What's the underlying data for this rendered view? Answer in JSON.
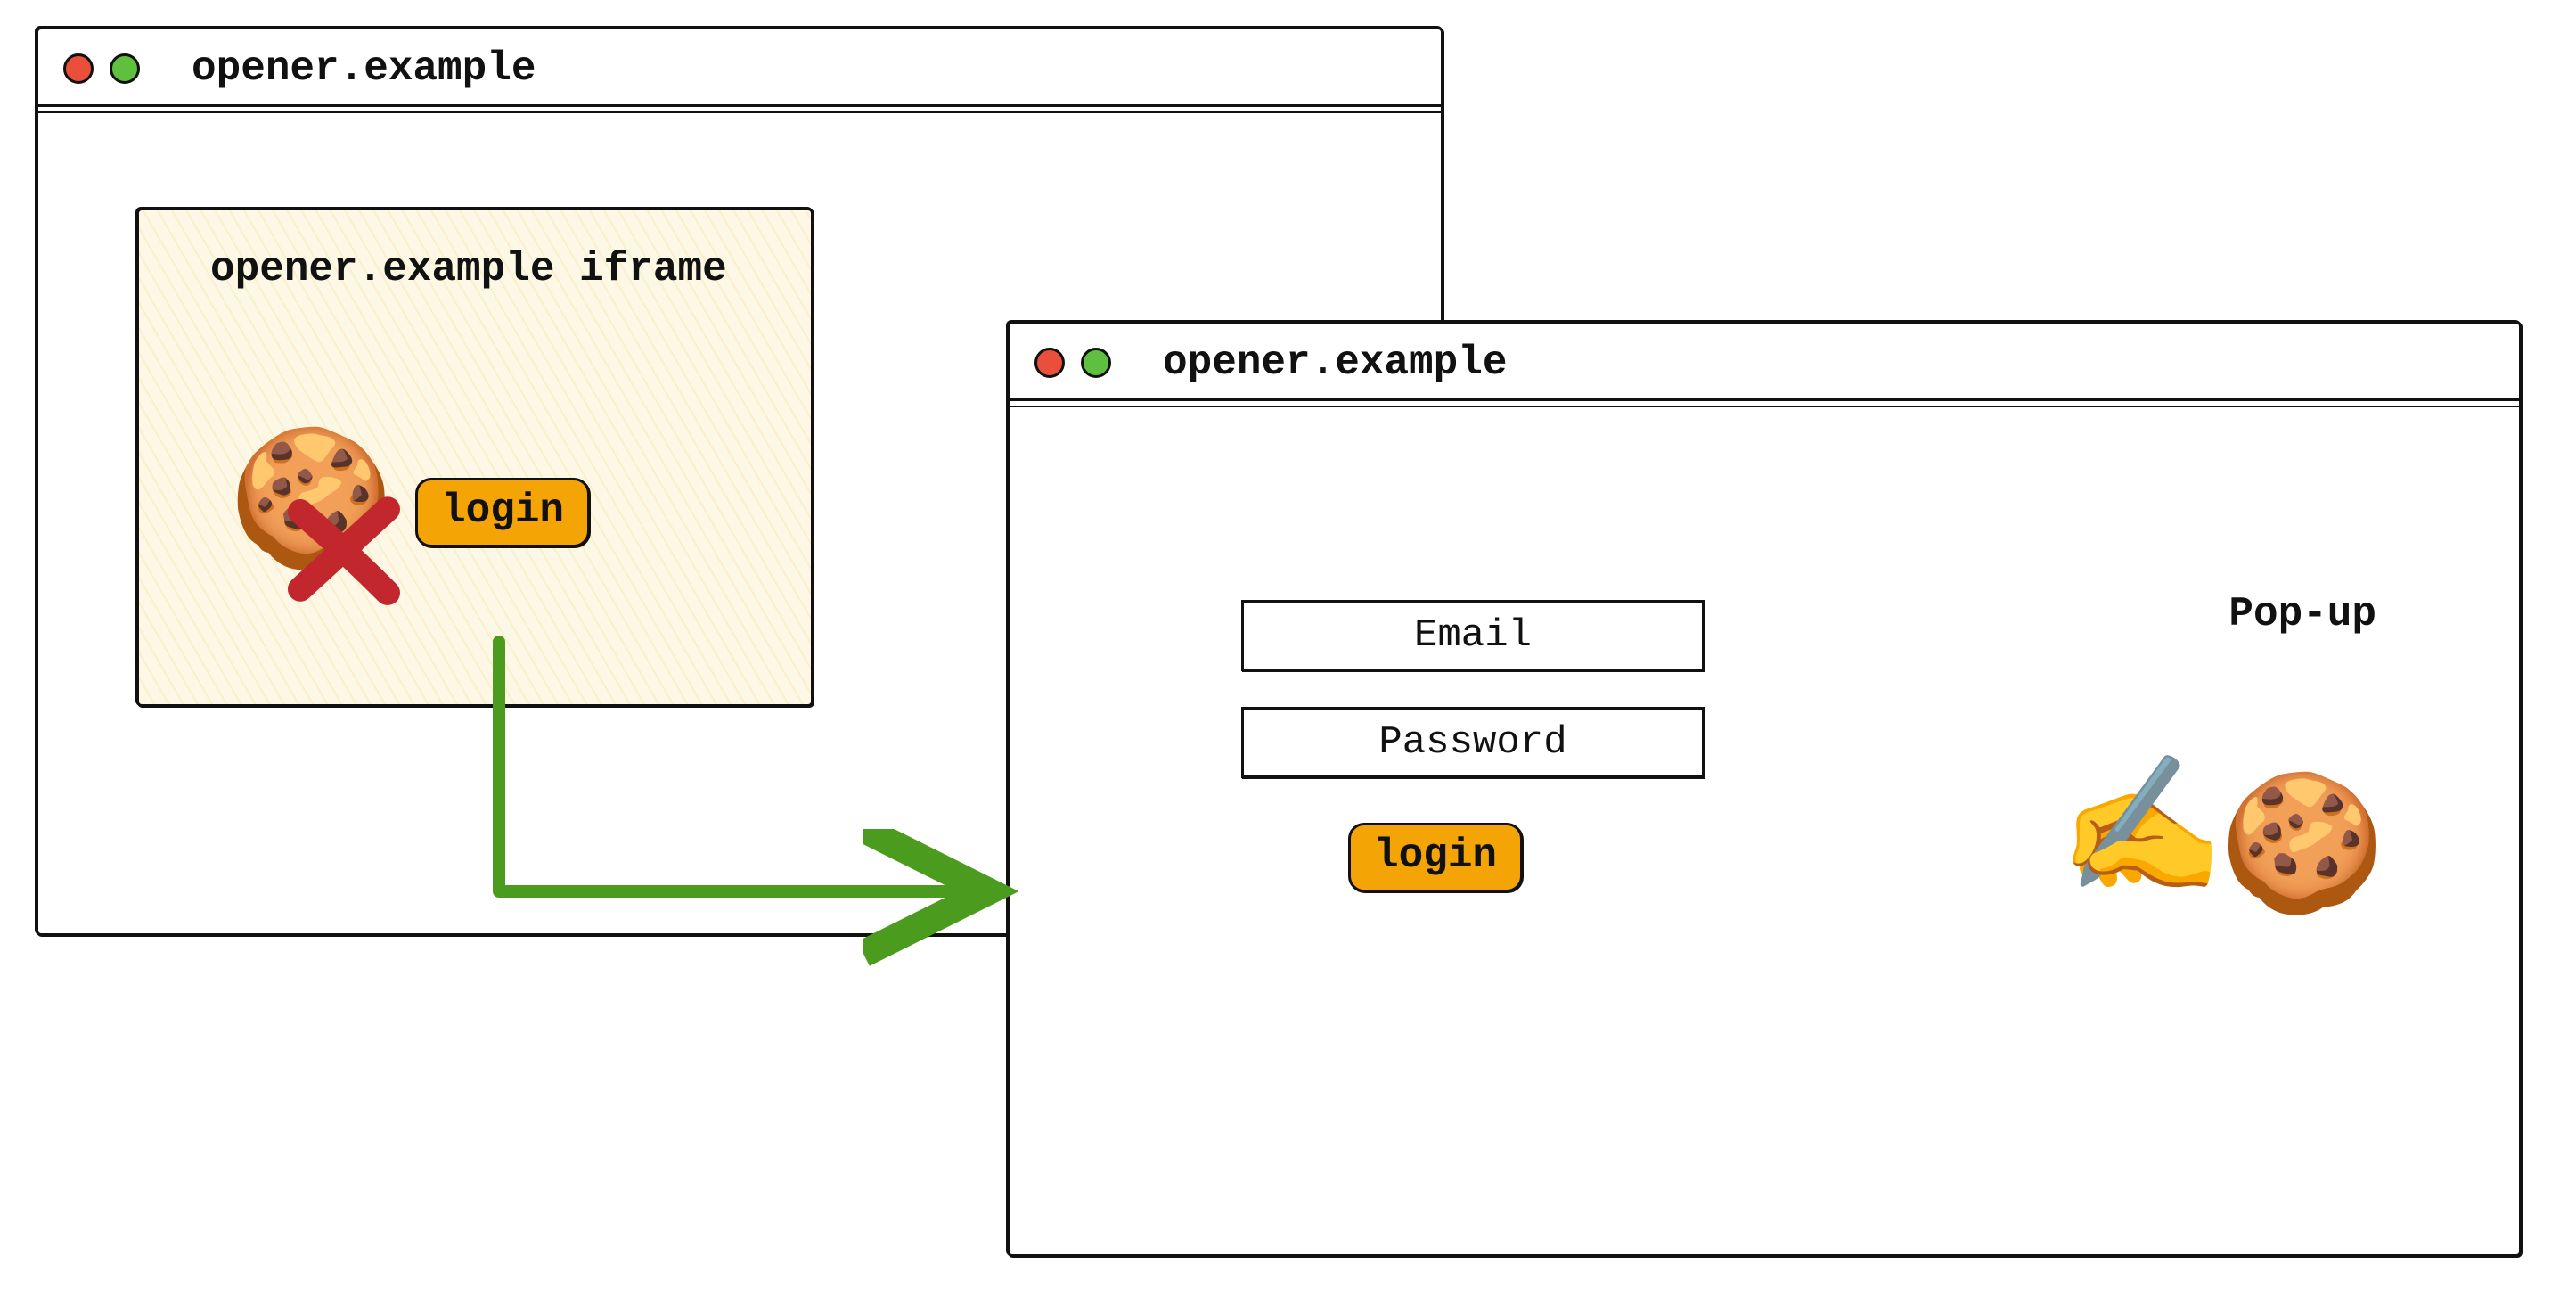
{
  "opener_window": {
    "title": "opener.example",
    "iframe": {
      "label": "opener.example iframe",
      "cookie_icon": "🍪",
      "cookie_blocked": true,
      "login_button": "login"
    }
  },
  "popup_window": {
    "title": "opener.example",
    "label": "Pop-up",
    "email_field": "Email",
    "password_field": "Password",
    "login_button": "login",
    "writing_icon": "✍️",
    "cookie_icon": "🍪"
  },
  "arrow": {
    "from": "iframe-login-button",
    "to": "popup-window",
    "color": "#4a9b1e"
  }
}
